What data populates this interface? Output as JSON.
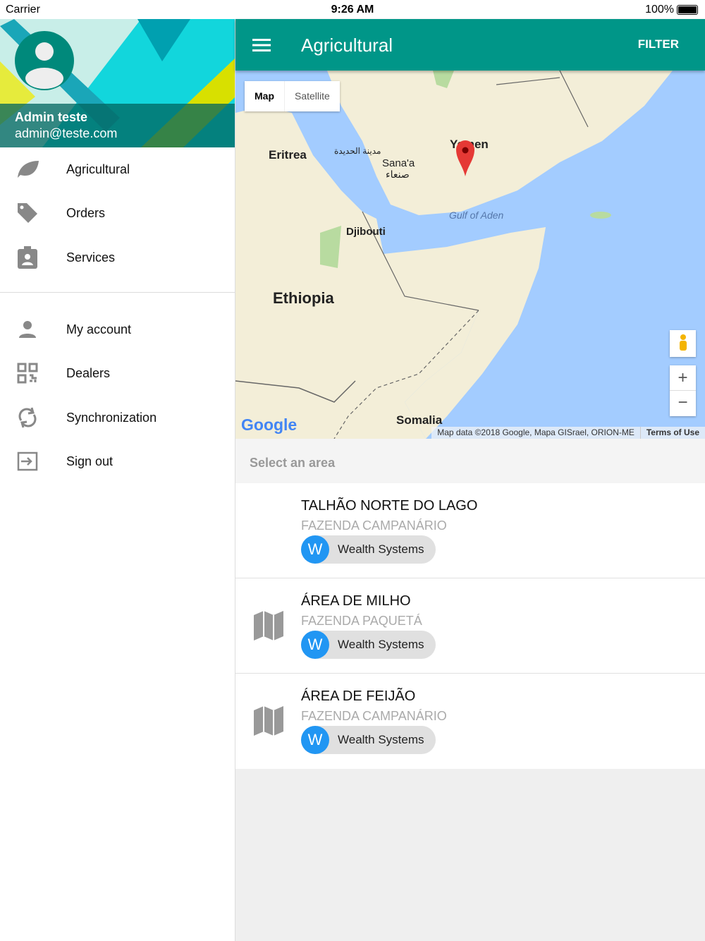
{
  "status": {
    "carrier": "Carrier",
    "time": "9:26 AM",
    "battery": "100%"
  },
  "drawer": {
    "user_name": "Admin teste",
    "user_email": "admin@teste.com",
    "items": [
      {
        "label": "Agricultural"
      },
      {
        "label": "Orders"
      },
      {
        "label": "Services"
      },
      {
        "label": "My account"
      },
      {
        "label": "Dealers"
      },
      {
        "label": "Synchronization"
      },
      {
        "label": "Sign out"
      }
    ]
  },
  "appbar": {
    "title": "Agricultural",
    "filter": "FILTER"
  },
  "map": {
    "type_map": "Map",
    "type_satellite": "Satellite",
    "labels": {
      "eritrea": "Eritrea",
      "djibouti": "Djibouti",
      "ethiopia": "Ethiopia",
      "somalia": "Somalia",
      "yemen": "Yemen",
      "sanaa": "Sana'a",
      "sanaa_ar": "صنعاء",
      "hodeidah": "مدينة الحديدة",
      "gulf": "Gulf of Aden"
    },
    "google": "Google",
    "attribution": "Map data ©2018 Google, Mapa GISrael, ORION-ME",
    "terms": "Terms of Use",
    "zoom_in": "+",
    "zoom_out": "−"
  },
  "select_label": "Select an area",
  "areas": [
    {
      "name": "TALHÃO NORTE DO LAGO",
      "farm": "FAZENDA CAMPANÁRIO",
      "dealer_initial": "W",
      "dealer": "Wealth Systems"
    },
    {
      "name": "ÁREA DE MILHO",
      "farm": "FAZENDA PAQUETÁ",
      "dealer_initial": "W",
      "dealer": "Wealth Systems"
    },
    {
      "name": "ÁREA DE FEIJÃO",
      "farm": "FAZENDA CAMPANÁRIO",
      "dealer_initial": "W",
      "dealer": "Wealth Systems"
    }
  ]
}
